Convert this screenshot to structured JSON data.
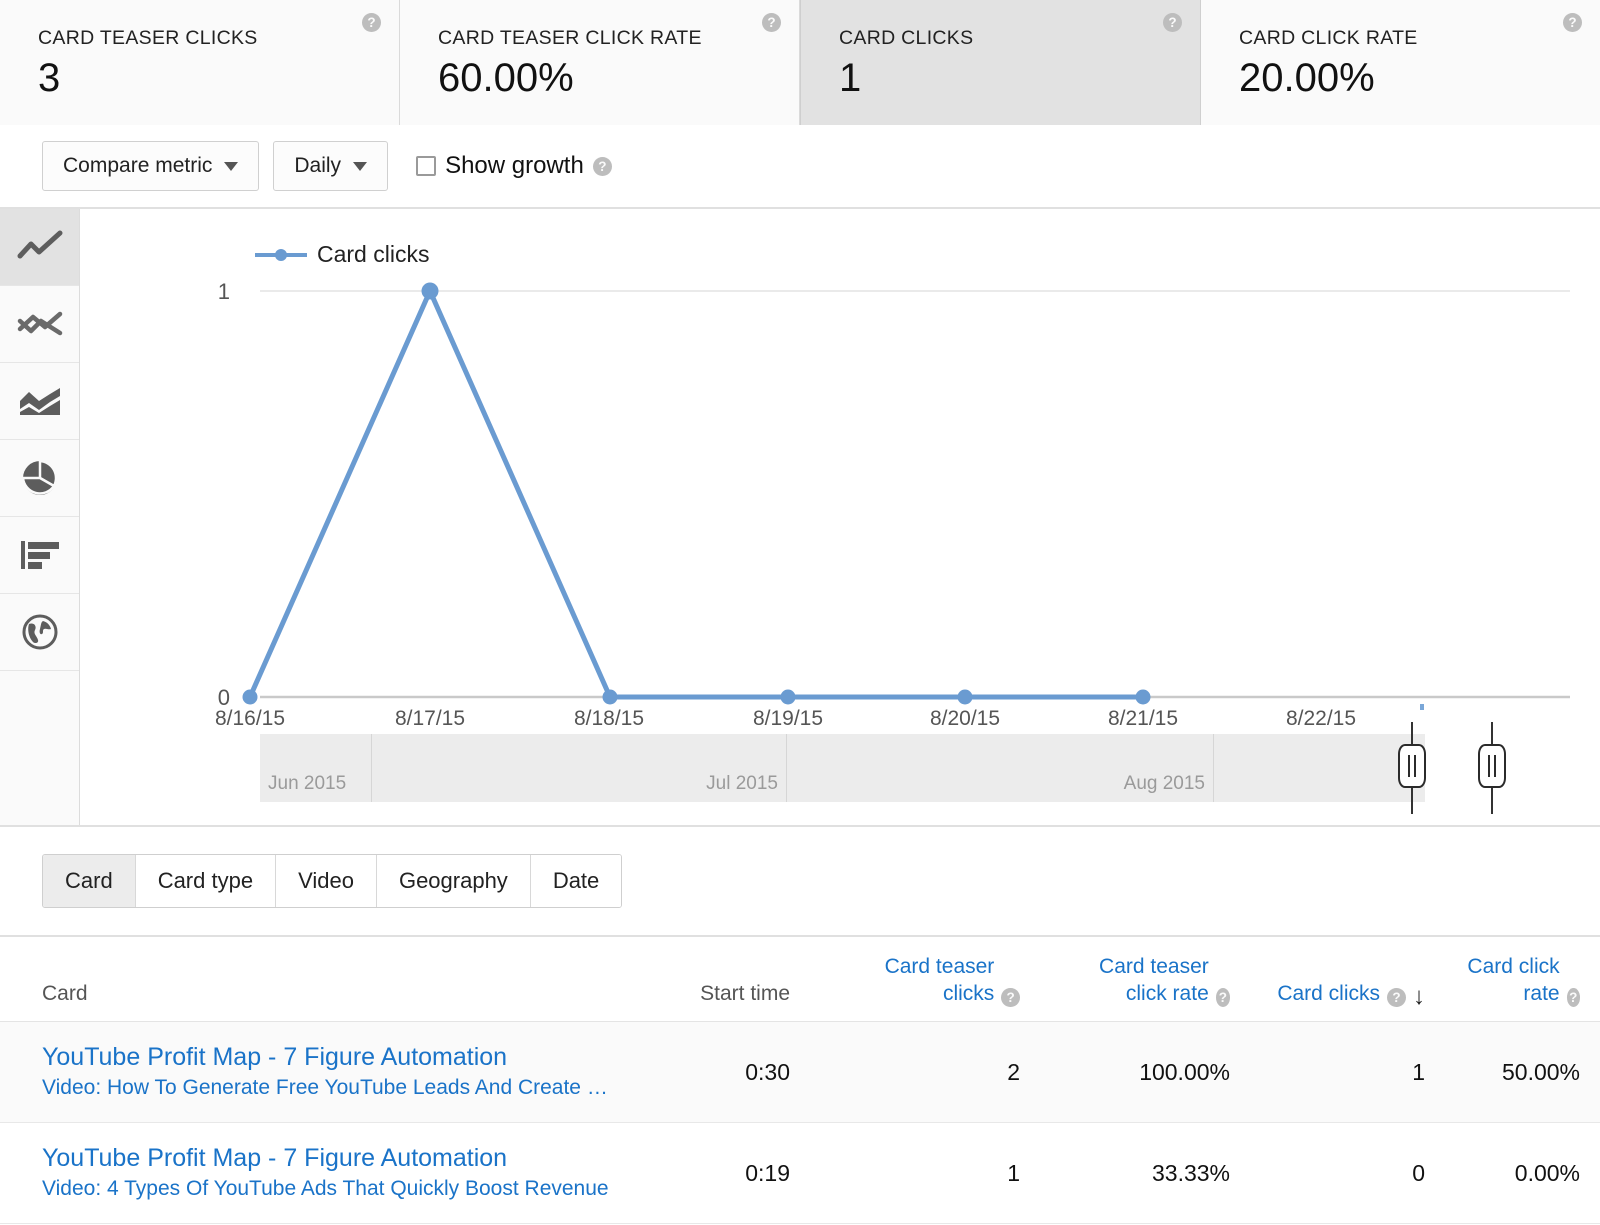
{
  "metrics": [
    {
      "label": "CARD TEASER CLICKS",
      "value": "3",
      "help": "?",
      "selected": false
    },
    {
      "label": "CARD TEASER CLICK RATE",
      "value": "60.00%",
      "help": "?",
      "selected": false
    },
    {
      "label": "CARD CLICKS",
      "value": "1",
      "help": "?",
      "selected": true
    },
    {
      "label": "CARD CLICK RATE",
      "value": "20.00%",
      "help": "?",
      "selected": false
    }
  ],
  "toolbar": {
    "compare_metric": "Compare metric",
    "granularity": "Daily",
    "show_growth": "Show growth",
    "show_growth_help": "?"
  },
  "chart_types": [
    {
      "name": "line-chart-icon",
      "selected": true
    },
    {
      "name": "multi-line-chart-icon",
      "selected": false
    },
    {
      "name": "stacked-area-chart-icon",
      "selected": false
    },
    {
      "name": "pie-chart-icon",
      "selected": false
    },
    {
      "name": "bar-chart-icon",
      "selected": false
    },
    {
      "name": "geography-map-icon",
      "selected": false
    }
  ],
  "chart_data": {
    "type": "line",
    "title": "",
    "xlabel": "",
    "ylabel": "",
    "legend": [
      "Card clicks"
    ],
    "legend_position": "top-left",
    "grid": true,
    "categories": [
      "8/16/15",
      "8/17/15",
      "8/18/15",
      "8/19/15",
      "8/20/15",
      "8/21/15",
      "8/22/15"
    ],
    "x": [
      "8/16/15",
      "8/17/15",
      "8/18/15",
      "8/19/15",
      "8/20/15",
      "8/21/15"
    ],
    "series": [
      {
        "name": "Card clicks",
        "values": [
          0,
          1,
          0,
          0,
          0,
          0
        ],
        "color": "#6a9bd1"
      }
    ],
    "ylim": [
      0,
      1
    ],
    "yticks": [
      "0",
      "1"
    ]
  },
  "range_slider": {
    "months": [
      "Jun 2015",
      "Jul 2015",
      "Aug 2015"
    ]
  },
  "tabs": [
    {
      "label": "Card",
      "selected": true
    },
    {
      "label": "Card type",
      "selected": false
    },
    {
      "label": "Video",
      "selected": false
    },
    {
      "label": "Geography",
      "selected": false
    },
    {
      "label": "Date",
      "selected": false
    }
  ],
  "table": {
    "columns": [
      {
        "label": "Card",
        "help": null,
        "link": false,
        "sorted": false
      },
      {
        "label": "Start time",
        "help": null,
        "link": false,
        "sorted": false
      },
      {
        "label": "Card teaser clicks",
        "help": "?",
        "link": true,
        "sorted": false
      },
      {
        "label": "Card teaser click rate",
        "help": "?",
        "link": true,
        "sorted": false
      },
      {
        "label": "Card clicks",
        "help": "?",
        "link": true,
        "sorted": true,
        "sort_arrow": "↓"
      },
      {
        "label": "Card click rate",
        "help": "?",
        "link": true,
        "sorted": false
      }
    ],
    "rows": [
      {
        "title": "YouTube Profit Map - 7 Figure Automation",
        "subtitle": "Video: How To Generate Free YouTube Leads And Create …",
        "start_time": "0:30",
        "card_teaser_clicks": "2",
        "card_teaser_click_rate": "100.00%",
        "card_clicks": "1",
        "card_click_rate": "50.00%"
      },
      {
        "title": "YouTube Profit Map - 7 Figure Automation",
        "subtitle": "Video: 4 Types Of YouTube Ads That Quickly Boost Revenue",
        "start_time": "0:19",
        "card_teaser_clicks": "1",
        "card_teaser_click_rate": "33.33%",
        "card_clicks": "0",
        "card_click_rate": "0.00%"
      }
    ]
  },
  "colors": {
    "link": "#1a73c8",
    "series": "#6a9bd1",
    "selected_bg": "#e2e2e2",
    "panel_bg": "#fafafa"
  }
}
